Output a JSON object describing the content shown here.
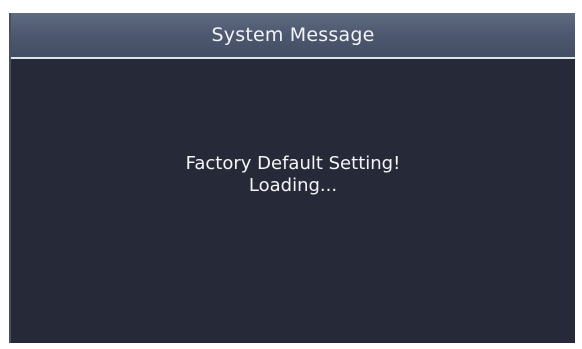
{
  "dialog": {
    "title": "System Message",
    "message_lines": [
      "Factory Default Setting!",
      "Loading..."
    ]
  }
}
